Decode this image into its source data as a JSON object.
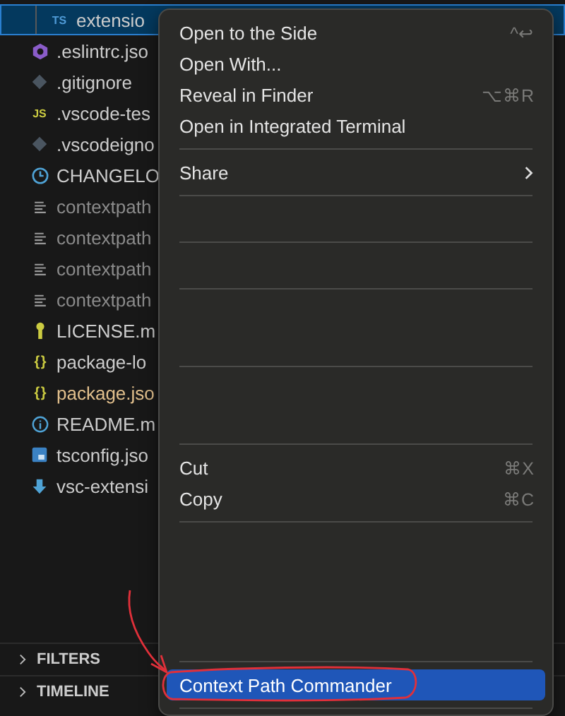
{
  "files": [
    {
      "name": "extensio",
      "kind": "ts",
      "badge": "TS",
      "ignored": false,
      "modified": false,
      "selected": true,
      "indent": true
    },
    {
      "name": ".eslintrc.jso",
      "kind": "eslint",
      "ignored": false,
      "modified": false,
      "selected": false
    },
    {
      "name": ".gitignore",
      "kind": "git",
      "ignored": false,
      "modified": false,
      "selected": false
    },
    {
      "name": ".vscode-tes",
      "kind": "js",
      "badge": "JS",
      "ignored": false,
      "modified": false,
      "selected": false
    },
    {
      "name": ".vscodeigno",
      "kind": "git",
      "ignored": false,
      "modified": false,
      "selected": false
    },
    {
      "name": "CHANGELO",
      "kind": "clock",
      "ignored": false,
      "modified": false,
      "selected": false
    },
    {
      "name": "contextpath",
      "kind": "lines",
      "ignored": true,
      "modified": false,
      "selected": false
    },
    {
      "name": "contextpath",
      "kind": "lines",
      "ignored": true,
      "modified": false,
      "selected": false
    },
    {
      "name": "contextpath",
      "kind": "lines",
      "ignored": true,
      "modified": false,
      "selected": false
    },
    {
      "name": "contextpath",
      "kind": "lines",
      "ignored": true,
      "modified": false,
      "selected": false
    },
    {
      "name": "LICENSE.m",
      "kind": "license",
      "ignored": false,
      "modified": false,
      "selected": false
    },
    {
      "name": "package-lo",
      "kind": "braces",
      "badge": "{ }",
      "ignored": false,
      "modified": false,
      "selected": false
    },
    {
      "name": "package.jso",
      "kind": "braces",
      "badge": "{ }",
      "ignored": false,
      "modified": true,
      "selected": false
    },
    {
      "name": "README.m",
      "kind": "info",
      "ignored": false,
      "modified": false,
      "selected": false
    },
    {
      "name": "tsconfig.jso",
      "kind": "tsconfig",
      "ignored": false,
      "modified": false,
      "selected": false
    },
    {
      "name": "vsc-extensi",
      "kind": "download",
      "ignored": false,
      "modified": false,
      "selected": false
    }
  ],
  "sections": [
    {
      "label": "FILTERS",
      "expanded": false
    },
    {
      "label": "TIMELINE",
      "expanded": false
    }
  ],
  "menu": [
    {
      "kind": "item",
      "label": "Open to the Side",
      "shortcut": "^↩",
      "selected": false
    },
    {
      "kind": "item",
      "label": "Open With...",
      "selected": false
    },
    {
      "kind": "item",
      "label": "Reveal in Finder",
      "shortcut": "⌥⌘R",
      "selected": false
    },
    {
      "kind": "item",
      "label": "Open in Integrated Terminal",
      "selected": false
    },
    {
      "kind": "separator"
    },
    {
      "kind": "item",
      "label": "Share",
      "submenu": true,
      "selected": false
    },
    {
      "kind": "separator"
    },
    {
      "kind": "blank"
    },
    {
      "kind": "separator"
    },
    {
      "kind": "blank"
    },
    {
      "kind": "separator"
    },
    {
      "kind": "blank"
    },
    {
      "kind": "blank"
    },
    {
      "kind": "separator"
    },
    {
      "kind": "blank"
    },
    {
      "kind": "blank"
    },
    {
      "kind": "separator"
    },
    {
      "kind": "item",
      "label": "Cut",
      "shortcut": "⌘X",
      "selected": false
    },
    {
      "kind": "item",
      "label": "Copy",
      "shortcut": "⌘C",
      "selected": false
    },
    {
      "kind": "separator"
    },
    {
      "kind": "blank"
    },
    {
      "kind": "blank"
    },
    {
      "kind": "blank"
    },
    {
      "kind": "blank"
    },
    {
      "kind": "separator"
    },
    {
      "kind": "item",
      "label": "Context Path Commander",
      "selected": true,
      "annotated": true
    },
    {
      "kind": "separator"
    }
  ]
}
